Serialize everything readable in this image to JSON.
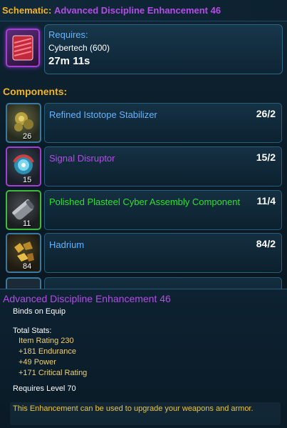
{
  "schematic": {
    "label": "Schematic:",
    "name": "Advanced Discipline Enhancement 46"
  },
  "requirements": {
    "title": "Requires:",
    "skill": "Cybertech (600)",
    "time": "27m 11s"
  },
  "components_label": "Components:",
  "components": [
    {
      "name": "Refined Istotope Stabilizer",
      "count": "26/2",
      "qty": "26",
      "name_color": "#66b3ff",
      "icon": "isotope-stabilizer-icon",
      "border_color": "#3a7aa0"
    },
    {
      "name": "Signal Disruptor",
      "count": "15/2",
      "qty": "15",
      "name_color": "#b34de6",
      "icon": "signal-disruptor-icon",
      "border_color": "#a43ed6"
    },
    {
      "name": "Polished Plasteel Cyber Assembly Component",
      "count": "11/4",
      "qty": "11",
      "name_color": "#2ee02e",
      "icon": "plasteel-component-icon",
      "border_color": "#3dbd3d"
    },
    {
      "name": "Hadrium",
      "count": "84/2",
      "qty": "84",
      "name_color": "#66b3ff",
      "icon": "hadrium-icon",
      "border_color": "#3a7aa0"
    }
  ],
  "tooltip": {
    "title": "Advanced Discipline Enhancement 46",
    "binds": "Binds on Equip",
    "total_stats_label": "Total Stats:",
    "stats": [
      "Item Rating 230",
      "+181 Endurance",
      "+49 Power",
      "+171 Critical Rating"
    ],
    "requires_level": "Requires Level 70",
    "description": "This Enhancement can be used to upgrade your weapons and armor."
  }
}
